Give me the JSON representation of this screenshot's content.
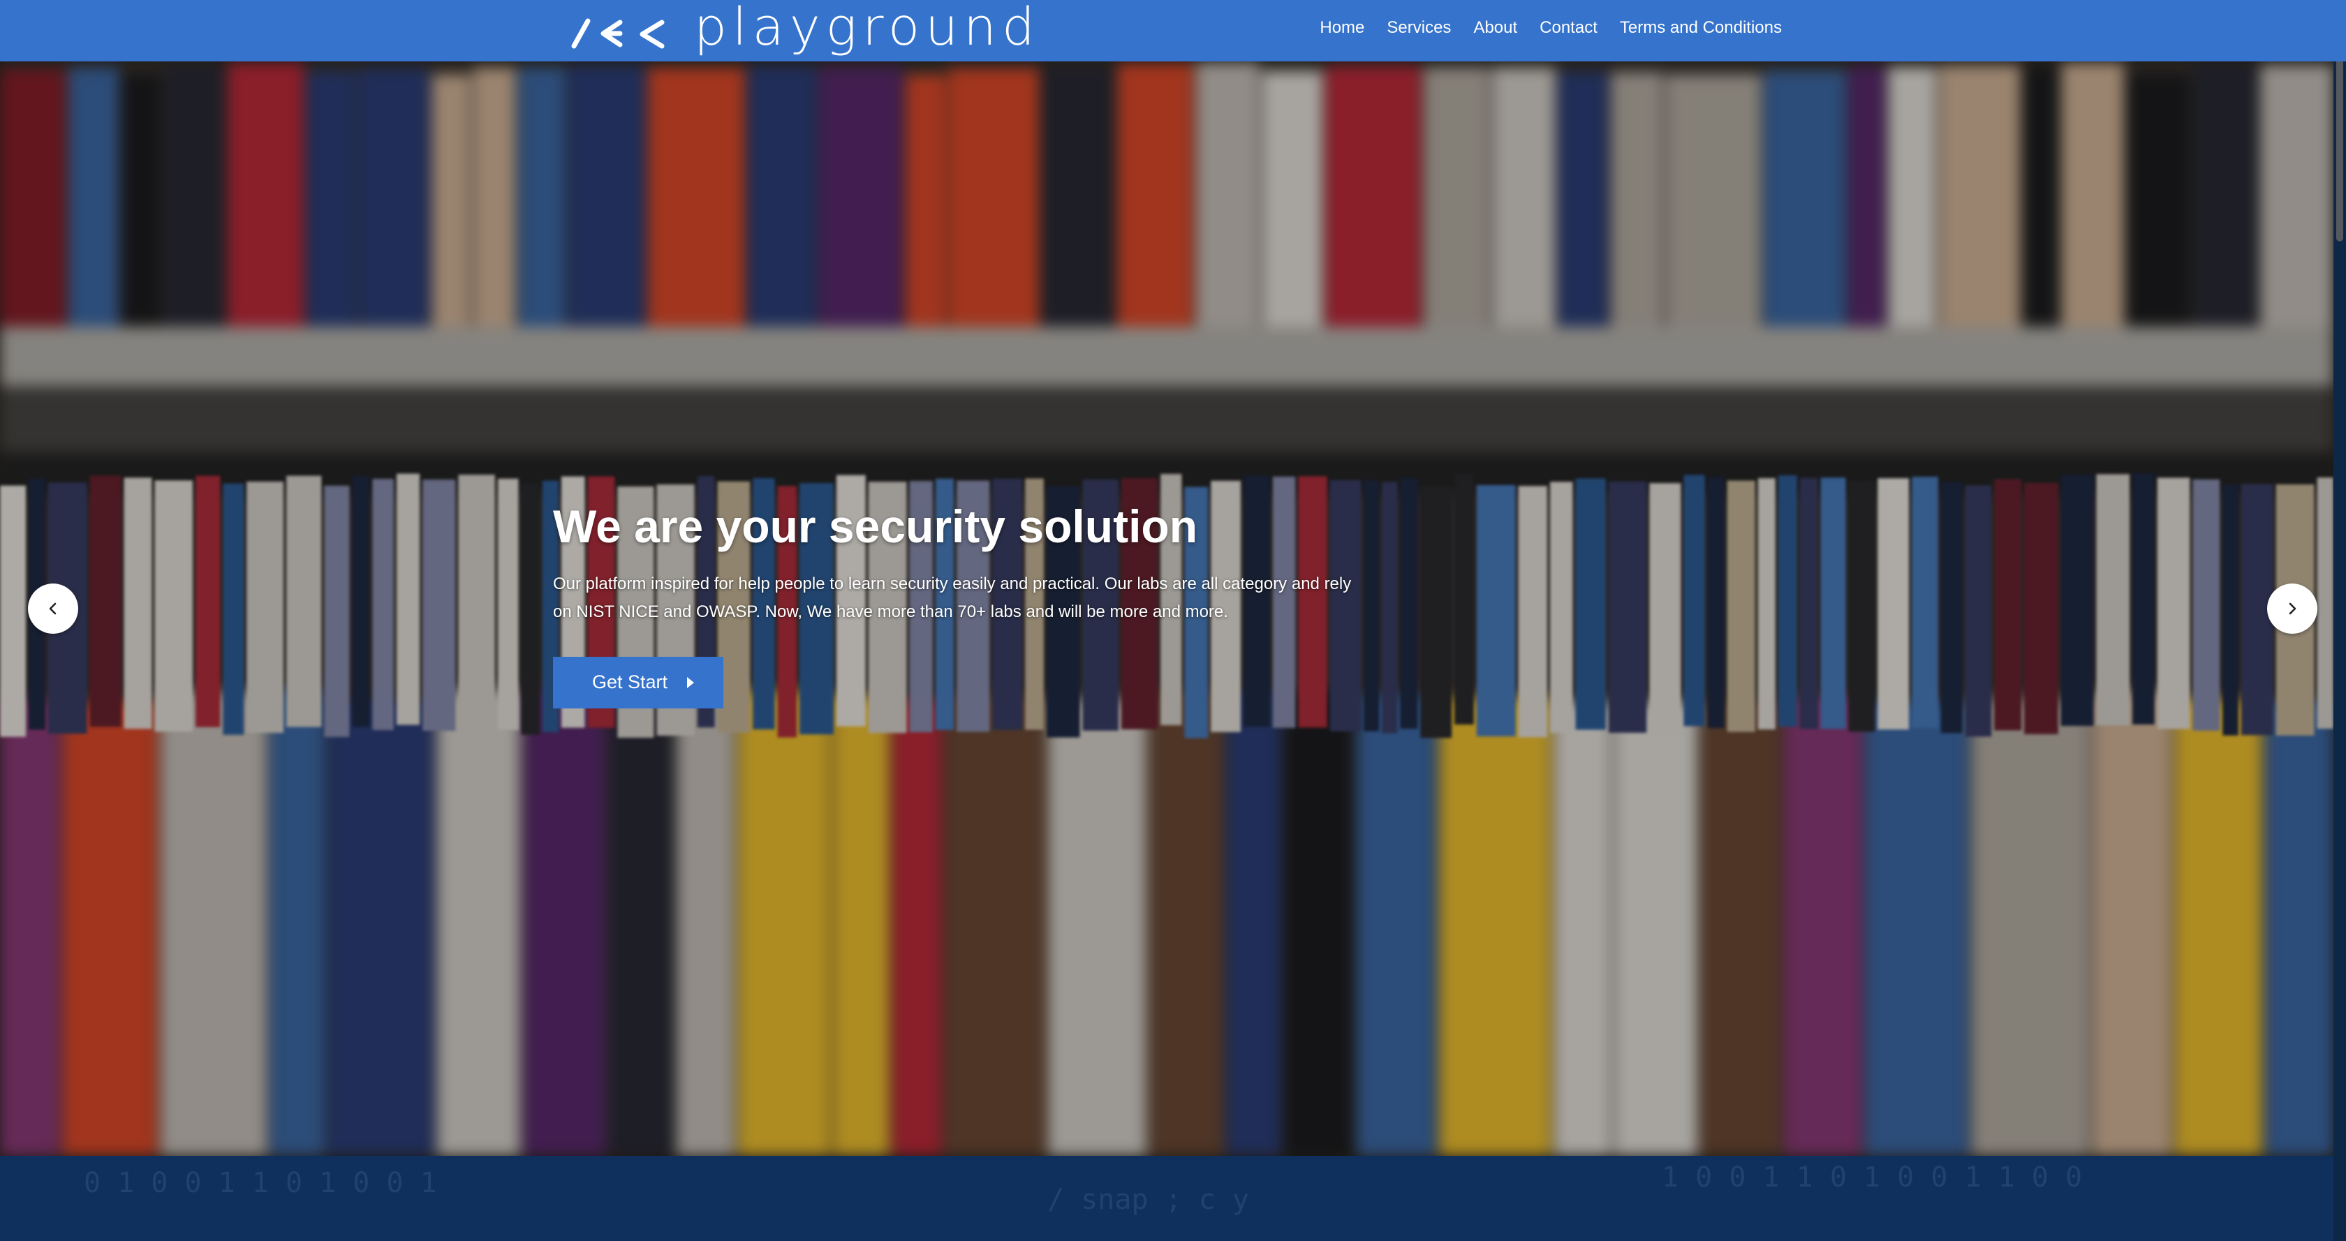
{
  "brand": {
    "name": "playground",
    "icon": "sec-logo-icon"
  },
  "nav": {
    "items": [
      {
        "label": "Home"
      },
      {
        "label": "Services"
      },
      {
        "label": "About"
      },
      {
        "label": "Contact"
      },
      {
        "label": "Terms and Conditions"
      }
    ]
  },
  "hero": {
    "title": "We are your security solution",
    "description": "Our platform inspired for help people to learn security easily and practical. Our labs are all category and rely on NIST NICE and OWASP. Now, We have more than 70+ labs and will be more and more.",
    "cta_label": "Get Start",
    "cta_icon": "caret-right-icon",
    "prev_icon": "chevron-left-icon",
    "next_icon": "chevron-right-icon"
  },
  "colors": {
    "accent": "#3573cc",
    "band": "#0f2f5c",
    "text_light": "#ffffff"
  }
}
